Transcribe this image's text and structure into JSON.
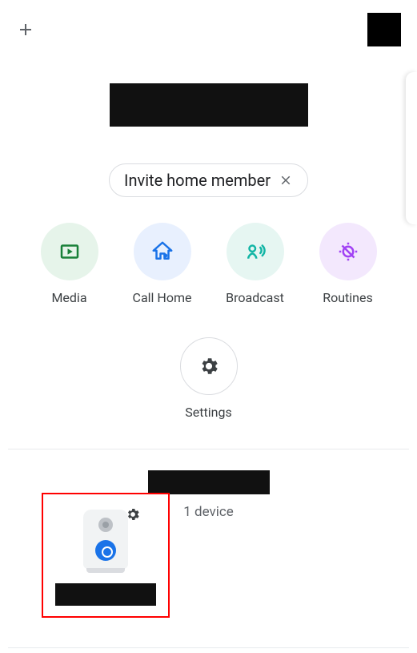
{
  "topbar": {
    "plus_icon": "plus-icon",
    "avatar": "account-avatar"
  },
  "home": {
    "title": "",
    "invite_chip": {
      "label": "Invite home member",
      "close_icon": "close-icon"
    }
  },
  "actions": [
    {
      "id": "media",
      "label": "Media",
      "icon": "play-circle-icon",
      "bg": "#e6f4ea",
      "color": "#188038"
    },
    {
      "id": "call-home",
      "label": "Call Home",
      "icon": "home-phone-icon",
      "bg": "#e8f0fe",
      "color": "#1a73e8"
    },
    {
      "id": "broadcast",
      "label": "Broadcast",
      "icon": "broadcast-icon",
      "bg": "#e6f6f2",
      "color": "#12b5a5"
    },
    {
      "id": "routines",
      "label": "Routines",
      "icon": "routines-icon",
      "bg": "#f3e8fd",
      "color": "#a142f4"
    },
    {
      "id": "settings",
      "label": "Settings",
      "icon": "gear-icon",
      "bg": "#ffffff",
      "color": "#3c4043"
    }
  ],
  "room": {
    "name": "",
    "device_count_label": "1 device"
  },
  "device": {
    "name": "",
    "icon": "speaker-icon",
    "gear_icon": "gear-icon"
  }
}
